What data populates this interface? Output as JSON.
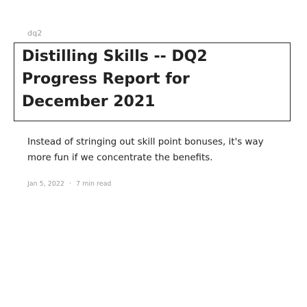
{
  "post": {
    "tag": "dq2",
    "title": "Distilling Skills -- DQ2 Progress Report for December 2021",
    "excerpt": "Instead of stringing out skill point bonuses, it's way more fun if we concentrate the benefits.",
    "date": "Jan 5, 2022",
    "separator": "·",
    "read_time": "7 min read"
  }
}
